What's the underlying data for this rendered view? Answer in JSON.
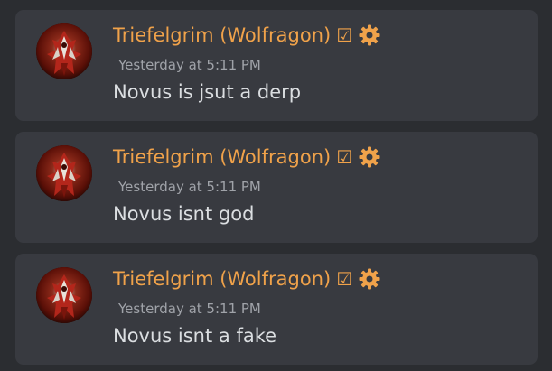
{
  "messages": [
    {
      "author": "Triefelgrim (Wolfragon)",
      "verified_icon": "checkbox-icon",
      "verified_glyph": "☑",
      "role_icon": "gear-icon",
      "timestamp": "Yesterday at 5:11 PM",
      "text": "Novus is jsut a derp"
    },
    {
      "author": "Triefelgrim (Wolfragon)",
      "verified_icon": "checkbox-icon",
      "verified_glyph": "☑",
      "role_icon": "gear-icon",
      "timestamp": "Yesterday at 5:11 PM",
      "text": "Novus isnt god"
    },
    {
      "author": "Triefelgrim (Wolfragon)",
      "verified_icon": "checkbox-icon",
      "verified_glyph": "☑",
      "role_icon": "gear-icon",
      "timestamp": "Yesterday at 5:11 PM",
      "text": "Novus isnt a fake"
    }
  ],
  "colors": {
    "background": "#2b2d31",
    "card": "#383a40",
    "username": "#f0a24a",
    "timestamp": "#a0a3a9",
    "message": "#dbdee1",
    "gear": "#f0a24a"
  }
}
